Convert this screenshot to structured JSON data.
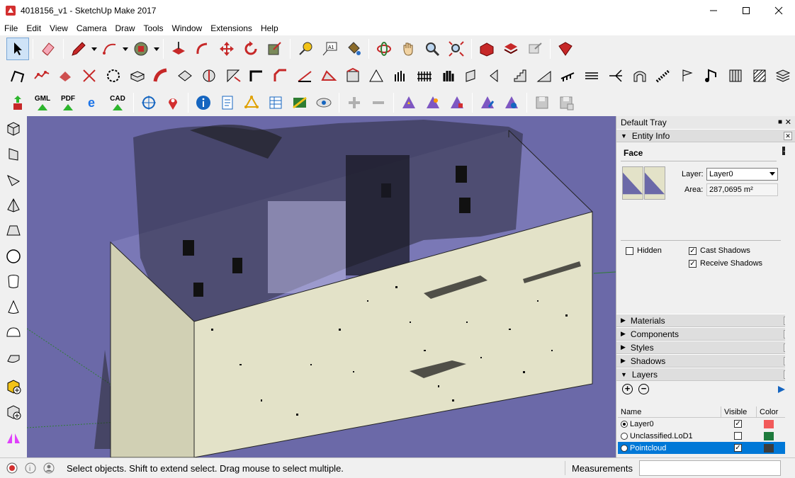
{
  "window": {
    "title": "4018156_v1 - SketchUp Make 2017",
    "controls": [
      "minimize",
      "maximize",
      "close"
    ]
  },
  "menu": [
    "File",
    "Edit",
    "View",
    "Camera",
    "Draw",
    "Tools",
    "Window",
    "Extensions",
    "Help"
  ],
  "toolbar3": {
    "gml": "GML",
    "pdf": "PDF",
    "cad": "CAD"
  },
  "tray": {
    "title": "Default Tray",
    "entity_info": {
      "title": "Entity Info",
      "type": "Face",
      "layer_label": "Layer:",
      "layer_value": "Layer0",
      "area_label": "Area:",
      "area_value": "287,0695 m²",
      "hidden_label": "Hidden",
      "hidden_checked": false,
      "cast_shadows_label": "Cast Shadows",
      "cast_shadows_checked": true,
      "receive_shadows_label": "Receive Shadows",
      "receive_shadows_checked": true
    },
    "panels": [
      "Materials",
      "Components",
      "Styles",
      "Shadows"
    ],
    "layers": {
      "title": "Layers",
      "columns": [
        "Name",
        "Visible",
        "Color"
      ],
      "rows": [
        {
          "name": "Layer0",
          "active": true,
          "visible": true,
          "color": "#f25a5a",
          "selected": false
        },
        {
          "name": "Unclassified.LoD1",
          "active": false,
          "visible": false,
          "color": "#1e7a3c",
          "selected": false
        },
        {
          "name": "Pointcloud",
          "active": false,
          "visible": true,
          "color": "#3c3c3c",
          "selected": true
        }
      ]
    }
  },
  "status": {
    "message": "Select objects. Shift to extend select. Drag mouse to select multiple.",
    "measurements_label": "Measurements",
    "measurements_value": ""
  },
  "colors": {
    "viewport_bg": "#6b69a8",
    "box_face_light": "#e3e2c8",
    "box_face_side": "#d1d0b4",
    "selection": "#0078d7"
  }
}
